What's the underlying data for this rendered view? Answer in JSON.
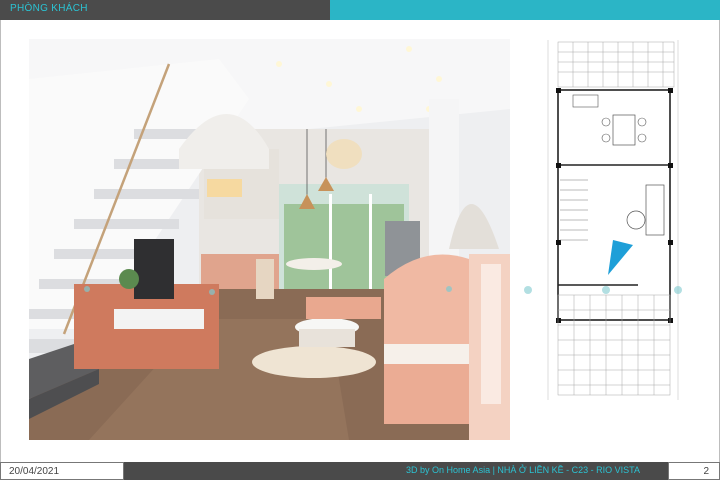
{
  "header": {
    "title": "PHÒNG KHÁCH"
  },
  "colors": {
    "accent": "#2bb5c6",
    "dark_bar": "#4b4b4b"
  },
  "render": {
    "alt": "Phối cảnh phòng khách"
  },
  "plan": {
    "alt": "Mặt bằng tầng"
  },
  "footer": {
    "date": "20/04/2021",
    "project": "3D by On Home Asia | NHÀ Ở LIỀN KỀ - C23 - RIO VISTA",
    "page": "2"
  }
}
